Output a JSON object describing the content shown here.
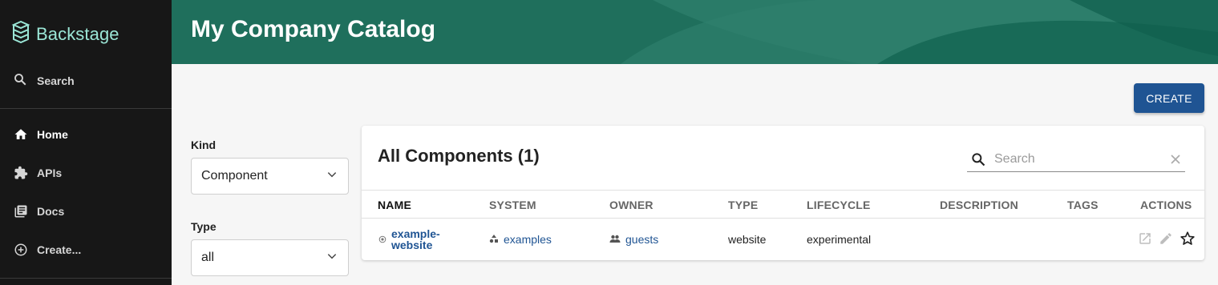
{
  "sidebar": {
    "logo_text": "Backstage",
    "search_label": "Search",
    "items": [
      {
        "label": "Home",
        "icon": "home-icon",
        "active": true
      },
      {
        "label": "APIs",
        "icon": "puzzle-icon",
        "active": false
      },
      {
        "label": "Docs",
        "icon": "library-icon",
        "active": false
      },
      {
        "label": "Create...",
        "icon": "add-circle-icon",
        "active": false
      }
    ]
  },
  "header": {
    "title": "My Company Catalog"
  },
  "toolbar": {
    "create_label": "CREATE"
  },
  "filters": {
    "kind": {
      "label": "Kind",
      "value": "Component"
    },
    "type": {
      "label": "Type",
      "value": "all"
    }
  },
  "table": {
    "title": "All Components (1)",
    "search_placeholder": "Search",
    "columns": [
      "NAME",
      "SYSTEM",
      "OWNER",
      "TYPE",
      "LIFECYCLE",
      "DESCRIPTION",
      "TAGS",
      "ACTIONS"
    ],
    "rows": [
      {
        "name_line1": "example-",
        "name_line2": "website",
        "system": "examples",
        "owner": "guests",
        "type": "website",
        "lifecycle": "experimental",
        "description": "",
        "tags": ""
      }
    ]
  },
  "colors": {
    "sidebar_bg": "#171717",
    "header_bg": "#1e6e5c",
    "accent": "#1f5493",
    "logo": "#9be6d6"
  }
}
